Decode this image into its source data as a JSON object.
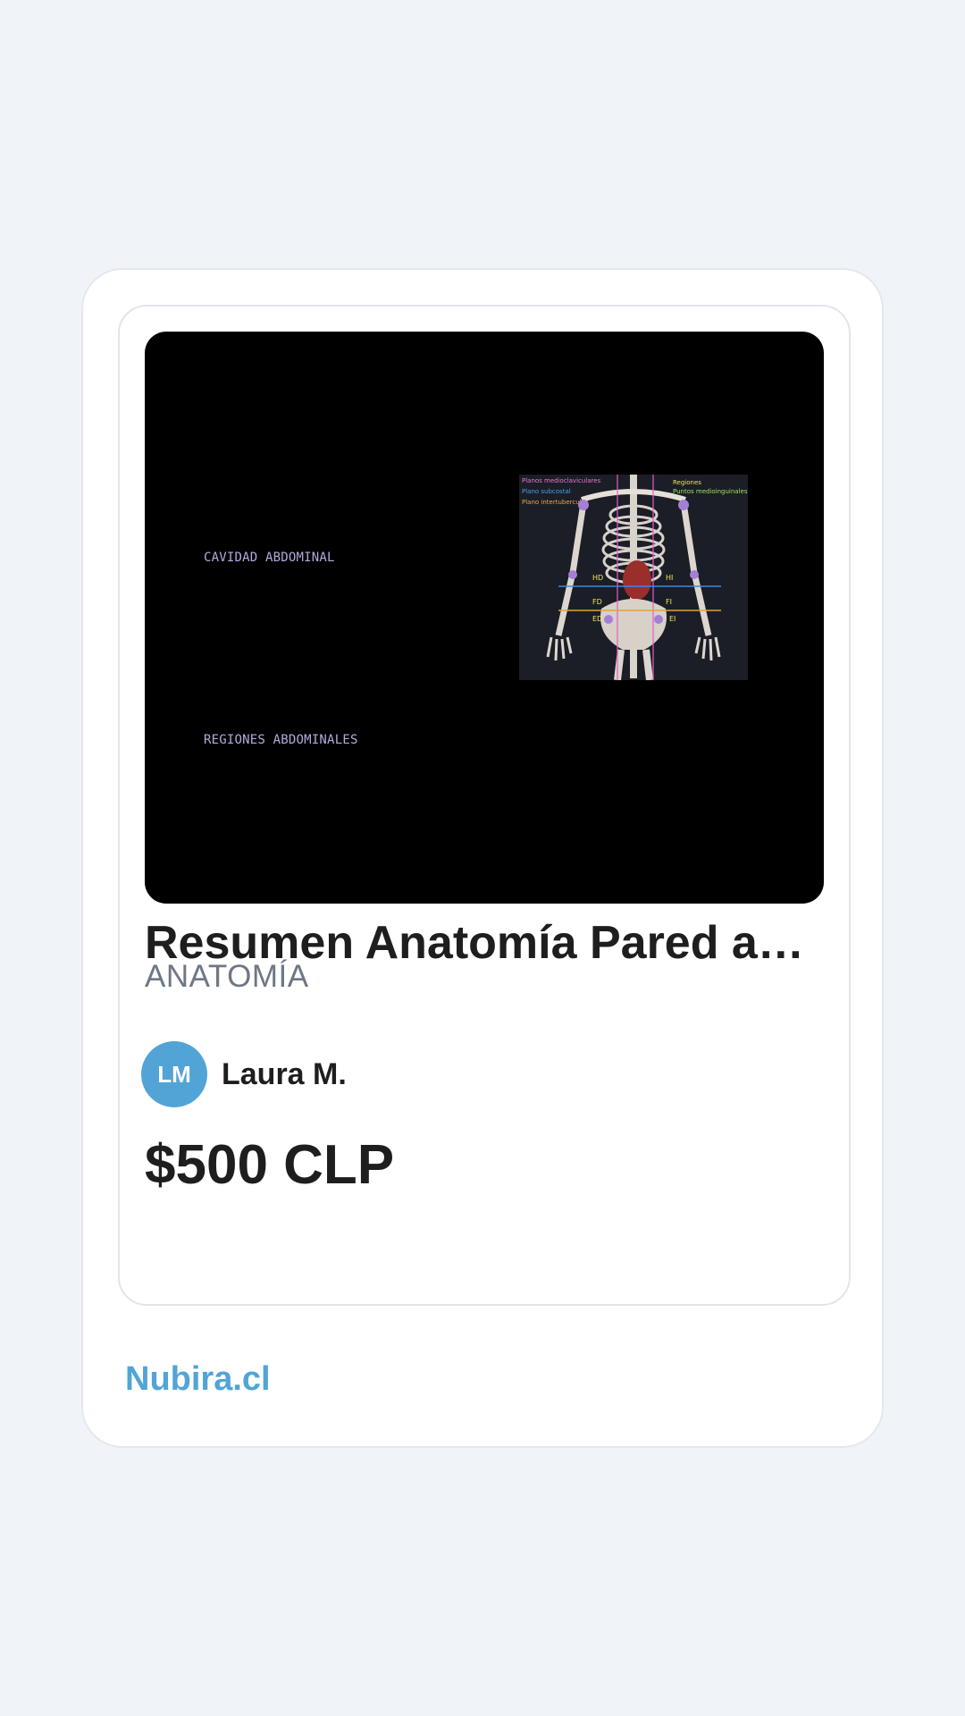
{
  "product": {
    "title": "Resumen Anatomía Pared an...",
    "category": "ANATOMÍA",
    "price": "$500 CLP",
    "preview": {
      "text_1": "CAVIDAD ABDOMINAL",
      "text_2": "REGIONES ABDOMINALES",
      "diagram": {
        "legend_left": [
          "Planos medioclaviculares",
          "Plano subcostal",
          "Plano intertuberculas"
        ],
        "legend_right": [
          "Regiones",
          "Puntos medioinguinales"
        ],
        "labels": [
          "HD",
          "HI",
          "FD",
          "FI",
          "ED",
          "EI"
        ]
      }
    }
  },
  "seller": {
    "initials": "LM",
    "name": "Laura M."
  },
  "brand": {
    "name": "Nubira.cl"
  },
  "colors": {
    "accent": "#52a4d7",
    "text": "#1e1e1e",
    "muted": "#6f7785",
    "background": "#f0f4f8"
  }
}
